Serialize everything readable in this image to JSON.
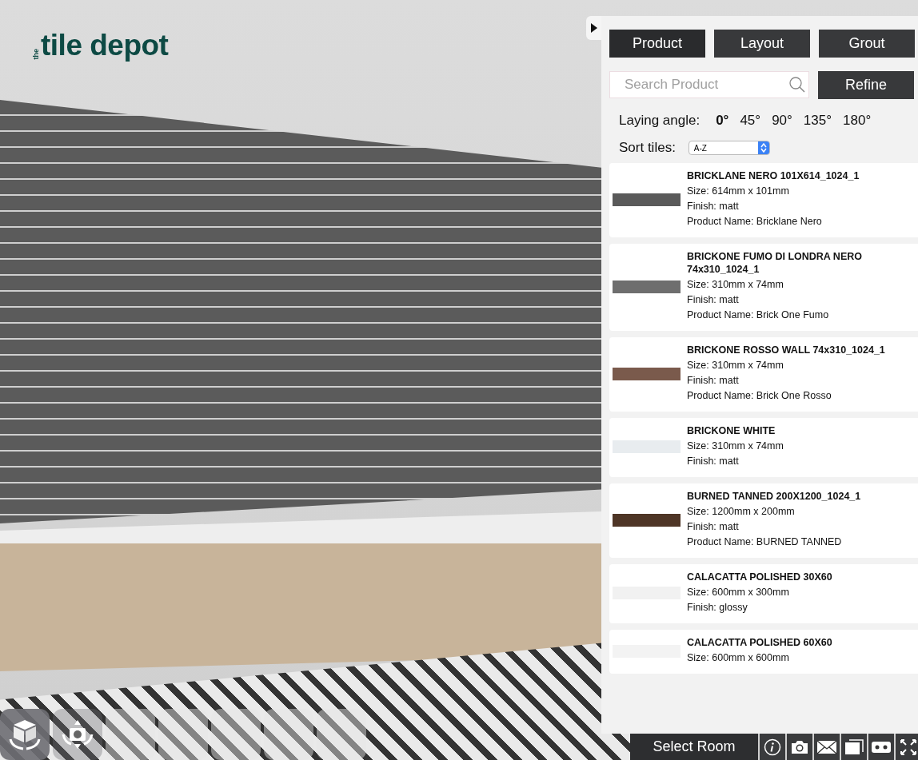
{
  "logo": {
    "small": "the",
    "main": "tile depot"
  },
  "tabs": [
    {
      "label": "Product",
      "selected": true
    },
    {
      "label": "Layout",
      "selected": false
    },
    {
      "label": "Grout",
      "selected": false
    }
  ],
  "search": {
    "placeholder": "Search Product"
  },
  "refine_button": "Refine",
  "laying_angle": {
    "label": "Laying angle:",
    "options": [
      {
        "label": "0°",
        "selected": true
      },
      {
        "label": "45°",
        "selected": false
      },
      {
        "label": "90°",
        "selected": false
      },
      {
        "label": "135°",
        "selected": false
      },
      {
        "label": "180°",
        "selected": false
      }
    ]
  },
  "sort": {
    "label": "Sort tiles:",
    "value": "A-Z"
  },
  "tiles": [
    {
      "name": "BRICKLANE NERO 101X614_1024_1",
      "color": "#5a5a5a",
      "lines": [
        "Size: 614mm x 101mm",
        "Finish: matt",
        "Product Name: Bricklane Nero"
      ]
    },
    {
      "name": "BRICKONE FUMO DI LONDRA NERO 74x310_1024_1",
      "color": "#6e6e6e",
      "lines": [
        "Size: 310mm x 74mm",
        "Finish: matt",
        "Product Name: Brick One Fumo"
      ]
    },
    {
      "name": "BRICKONE ROSSO WALL 74x310_1024_1",
      "color": "#7a5a4c",
      "lines": [
        "Size: 310mm x 74mm",
        "Finish: matt",
        "Product Name: Brick One Rosso"
      ]
    },
    {
      "name": "BRICKONE WHITE",
      "color": "#e8ecef",
      "lines": [
        "Size: 310mm x 74mm",
        "Finish: matt"
      ]
    },
    {
      "name": "BURNED TANNED 200X1200_1024_1",
      "color": "#4e3526",
      "lines": [
        "Size: 1200mm x 200mm",
        "Finish: matt",
        "Product Name: BURNED TANNED"
      ]
    },
    {
      "name": "CALACATTA POLISHED 30X60",
      "color": "#f1f1f1",
      "lines": [
        "Size: 600mm x 300mm",
        "Finish: glossy"
      ]
    },
    {
      "name": "CALACATTA POLISHED 60X60",
      "color": "#f3f3f3",
      "lines": [
        "Size: 600mm x 600mm"
      ]
    }
  ],
  "bottom_bar": {
    "select_room": "Select Room"
  },
  "rooms": [
    {
      "kind": "rotate-view"
    },
    {
      "kind": "rotate-camera"
    },
    {
      "kind": "room"
    },
    {
      "kind": "room"
    },
    {
      "kind": "room"
    },
    {
      "kind": "room"
    },
    {
      "kind": "room"
    }
  ]
}
